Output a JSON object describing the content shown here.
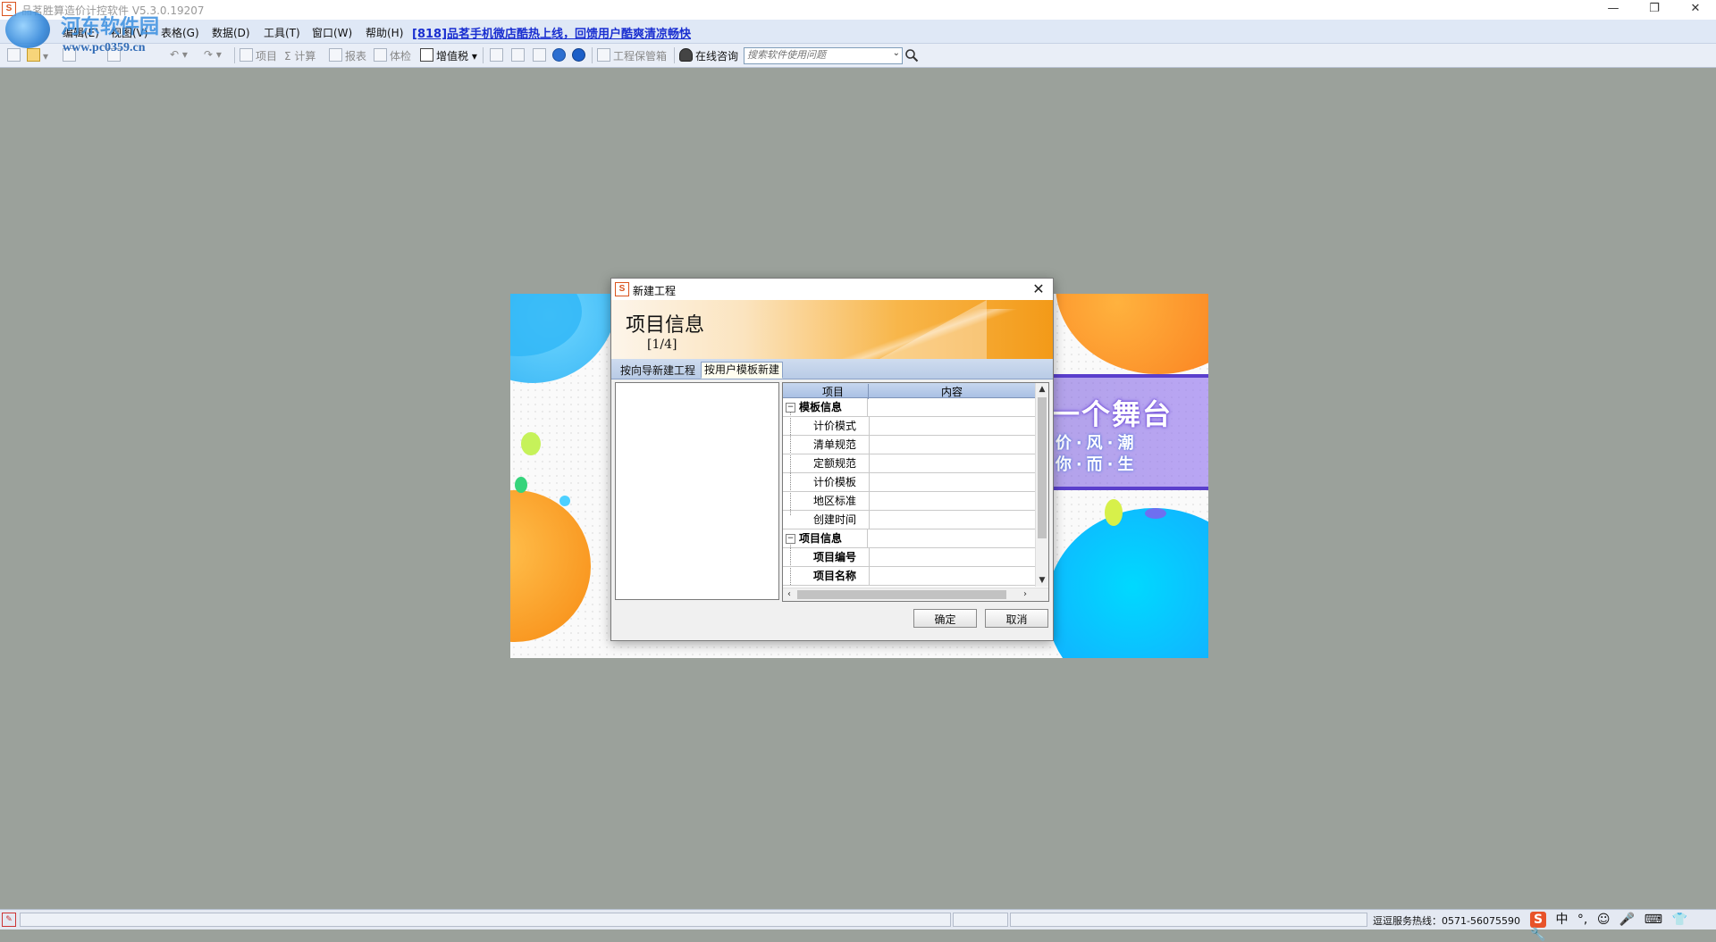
{
  "window": {
    "title": "品茗胜算造价计控软件  V5.3.0.19207",
    "app_icon": "S",
    "controls": {
      "minimize": "—",
      "restore": "❐",
      "close": "✕"
    }
  },
  "watermark": {
    "line1": "河东软件园",
    "line2": "www.pc0359.cn"
  },
  "menu": {
    "items": [
      "编辑(E)",
      "视图(V)",
      "表格(G)",
      "数据(D)",
      "工具(T)",
      "窗口(W)",
      "帮助(H)"
    ],
    "promo": "[818]品茗手机微店酷热上线，回馈用户酷爽清凉畅快"
  },
  "toolbar": {
    "project": "项目",
    "calc": "计算",
    "report": "报表",
    "check": "体检",
    "vat": "增值税",
    "archive": "工程保管箱",
    "consult": "在线咨询",
    "search_placeholder": "搜索软件使用问题"
  },
  "splash": {
    "slogan": "一个舞台",
    "slogan_line2": "·价·风·潮",
    "slogan_line3": "·你·而·生"
  },
  "dialog": {
    "title": "新建工程",
    "banner_heading": "项目信息",
    "banner_step": "[1/4]",
    "tabs": [
      "按向导新建工程",
      "按用户模板新建"
    ],
    "grid": {
      "headers": [
        "项目",
        "内容"
      ],
      "groups": [
        {
          "label": "模板信息",
          "toggle": "−",
          "rows": [
            "计价模式",
            "清单规范",
            "定额规范",
            "计价模板",
            "地区标准",
            "创建时间"
          ]
        },
        {
          "label": "项目信息",
          "toggle": "−",
          "rows": [
            "项目编号",
            "项目名称"
          ]
        }
      ]
    },
    "ok": "确定",
    "cancel": "取消"
  },
  "statusbar": {
    "hotline": "逗逗服务热线：0571-56075590",
    "ime": {
      "logo": "S",
      "mode": "中",
      "punct": "°,",
      "emoji": "☺",
      "mic": "🎤",
      "keyboard": "⌨"
    }
  },
  "colors": {
    "accent_orange": "#f39a18",
    "menu_bg": "#dfe8f6",
    "desktop_bg": "#9ba19b",
    "promo_link": "#1a2fd0"
  }
}
